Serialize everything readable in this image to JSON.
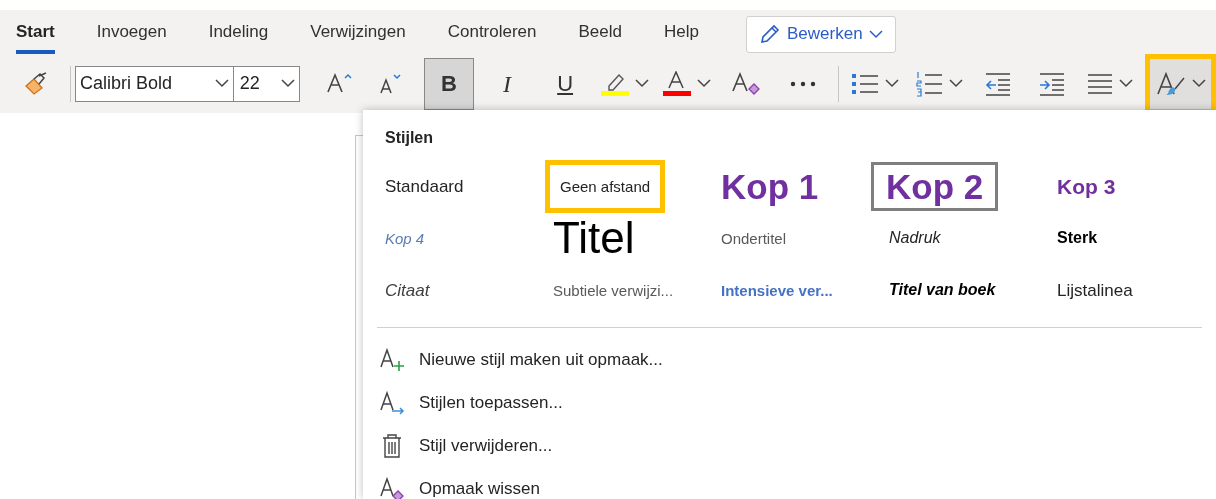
{
  "tabs": [
    {
      "label": "Start",
      "selected": true
    },
    {
      "label": "Invoegen",
      "selected": false
    },
    {
      "label": "Indeling",
      "selected": false
    },
    {
      "label": "Verwijzingen",
      "selected": false
    },
    {
      "label": "Controleren",
      "selected": false
    },
    {
      "label": "Beeld",
      "selected": false
    },
    {
      "label": "Help",
      "selected": false
    }
  ],
  "mode_button": {
    "label": "Bewerken"
  },
  "toolbar": [
    {
      "kind": "format-painter"
    },
    {
      "kind": "separator"
    },
    {
      "kind": "font-select",
      "value": "Calibri Bold"
    },
    {
      "kind": "size-select",
      "value": "22"
    },
    {
      "kind": "grow-font"
    },
    {
      "kind": "shrink-font"
    },
    {
      "kind": "bold",
      "label": "B",
      "on": true
    },
    {
      "kind": "italic",
      "label": "I",
      "on": false
    },
    {
      "kind": "underline",
      "label": "U",
      "on": false
    },
    {
      "kind": "highlight",
      "color": "#ffff00"
    },
    {
      "kind": "font-color",
      "color": "#ff0000"
    },
    {
      "kind": "clear-format"
    },
    {
      "kind": "more"
    },
    {
      "kind": "separator"
    },
    {
      "kind": "bullets"
    },
    {
      "kind": "numbering"
    },
    {
      "kind": "outdent"
    },
    {
      "kind": "indent"
    },
    {
      "kind": "align"
    },
    {
      "kind": "styles",
      "on": true,
      "callout": true
    }
  ],
  "styles_panel": {
    "title": "Stijlen",
    "styles": [
      {
        "label": "Standaard",
        "kind": "standard",
        "selected": false,
        "callout": false
      },
      {
        "label": "Geen afstand",
        "kind": "no-spacing",
        "selected": false,
        "callout": true
      },
      {
        "label": "Kop 1",
        "kind": "heading1",
        "selected": false,
        "callout": false
      },
      {
        "label": "Kop 2",
        "kind": "heading2",
        "selected": true,
        "callout": false
      },
      {
        "label": "Kop 3",
        "kind": "heading3",
        "selected": false,
        "callout": false
      },
      {
        "label": "Kop 4",
        "kind": "heading4",
        "selected": false,
        "callout": false
      },
      {
        "label": "Titel",
        "kind": "title",
        "selected": false,
        "callout": false
      },
      {
        "label": "Ondertitel",
        "kind": "subtitle",
        "selected": false,
        "callout": false
      },
      {
        "label": "Nadruk",
        "kind": "emphasis",
        "selected": false,
        "callout": false
      },
      {
        "label": "Sterk",
        "kind": "strong",
        "selected": false,
        "callout": false
      },
      {
        "label": "Citaat",
        "kind": "quote",
        "selected": false,
        "callout": false
      },
      {
        "label": "Subtiele verwijzi...",
        "kind": "subtle-ref",
        "selected": false,
        "callout": false
      },
      {
        "label": "Intensieve ver...",
        "kind": "intense-ref",
        "selected": false,
        "callout": false
      },
      {
        "label": "Titel van boek",
        "kind": "book-title",
        "selected": false,
        "callout": false
      },
      {
        "label": "Lijstalinea",
        "kind": "list-paragraph",
        "selected": false,
        "callout": false
      }
    ],
    "actions": [
      {
        "label": "Nieuwe stijl maken uit opmaak...",
        "kind": "new"
      },
      {
        "label": "Stijlen toepassen...",
        "kind": "apply"
      },
      {
        "label": "Stijl verwijderen...",
        "kind": "delete"
      },
      {
        "label": "Opmaak wissen",
        "kind": "clear"
      }
    ]
  }
}
